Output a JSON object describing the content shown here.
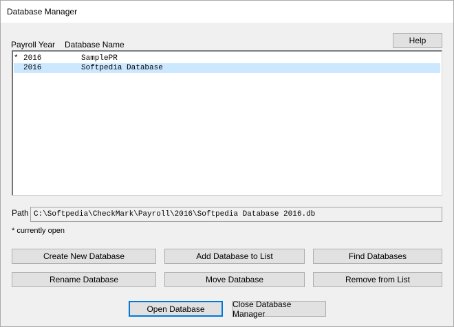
{
  "window": {
    "title": "Database Manager"
  },
  "list": {
    "col_year": "Payroll Year",
    "col_name": "Database Name",
    "rows": [
      {
        "mark": "*",
        "year": "2016",
        "name": "SamplePR",
        "selected": false
      },
      {
        "mark": "",
        "year": "2016",
        "name": "Softpedia Database",
        "selected": true
      }
    ]
  },
  "buttons": {
    "help": "Help",
    "create": "Create New Database",
    "add": "Add Database to List",
    "find": "Find Databases",
    "rename": "Rename Database",
    "move": "Move Database",
    "remove": "Remove from List",
    "open": "Open Database",
    "close": "Close Database Manager"
  },
  "path": {
    "label": "Path",
    "value": "C:\\Softpedia\\CheckMark\\Payroll\\2016\\Softpedia Database 2016.db"
  },
  "note": "* currently open",
  "colors": {
    "selection": "#cce8ff",
    "default_button_border": "#0078d7"
  }
}
